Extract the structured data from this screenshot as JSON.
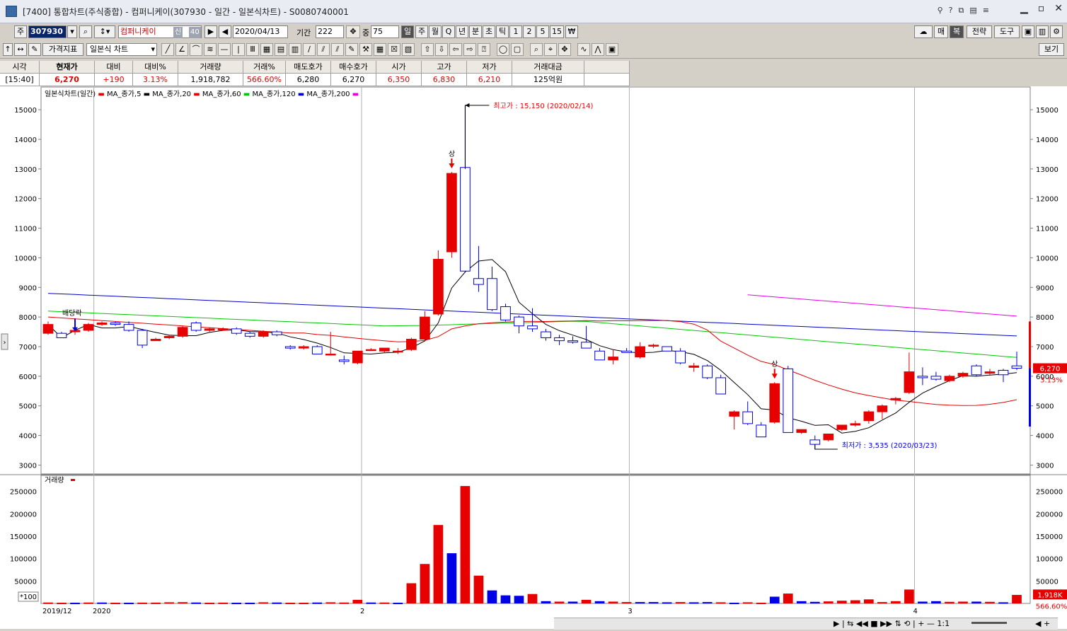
{
  "window": {
    "title": "[7400] 통합차트(주식종합) - 컴퍼니케이(307930 - 일간 - 일본식차트) - S0080740001"
  },
  "toolbar1": {
    "market": "주",
    "code": "307930",
    "name": "컴퍼니케이",
    "badge": "신",
    "badge2": "40",
    "date": "2020/04/13",
    "period_label": "기간",
    "period": "222",
    "zoom_label": "중",
    "zoom": "75",
    "periods": [
      "일",
      "주",
      "월",
      "Q",
      "년",
      "분",
      "초",
      "틱",
      "1",
      "2",
      "5",
      "15"
    ],
    "right_buttons": [
      "매",
      "복",
      "전략",
      "도구"
    ]
  },
  "toolbar2": {
    "indicator_label": "가격지표",
    "chart_type": "일본식 차트",
    "view_label": "보기"
  },
  "quote": {
    "headers": [
      "시각",
      "현재가",
      "대비",
      "대비%",
      "거래량",
      "거래%",
      "매도호가",
      "매수호가",
      "시가",
      "고가",
      "저가",
      "거래대금"
    ],
    "values": [
      "[15:40]",
      "6,270",
      "+190",
      "3.13%",
      "1,918,782",
      "566.60%",
      "6,280",
      "6,270",
      "6,350",
      "6,830",
      "6,210",
      "125억원"
    ]
  },
  "legend": {
    "title": "일본식차트(일간)",
    "items": [
      {
        "label": "MA_종가,5",
        "color": "#000000"
      },
      {
        "label": "MA_종가,20",
        "color": "#e60000"
      },
      {
        "label": "MA_종가,60",
        "color": "#00c800"
      },
      {
        "label": "MA_종가,120",
        "color": "#0000c8"
      },
      {
        "label": "MA_종가,200",
        "color": "#e600e6"
      }
    ],
    "marker_color": "#e60000"
  },
  "annotations": {
    "high": "최고가 : 15,150 (2020/02/14)",
    "low": "최저가 : 3,535 (2020/03/23)",
    "dividend": "배당락",
    "limit_up": "상",
    "price_tag": "6,270",
    "pct_tag": "3.13%",
    "vol_title": "거래량",
    "vol_tag": "1,918K",
    "vol_pct": "566.60%",
    "x100": "*100"
  },
  "colors": {
    "up": "#e60000",
    "down": "#0000e6",
    "ma5": "#000000",
    "ma20": "#e60000",
    "ma60": "#00c800",
    "ma120": "#0000c8",
    "ma200": "#e600e6"
  },
  "chart_data": {
    "type": "candlestick",
    "x_labels": [
      "2019/12",
      "2020",
      "2",
      "3",
      "4"
    ],
    "price_ticks": [
      3000,
      4000,
      5000,
      6000,
      7000,
      8000,
      9000,
      10000,
      11000,
      12000,
      13000,
      14000,
      15000
    ],
    "volume_ticks": [
      50000,
      100000,
      150000,
      200000,
      250000
    ],
    "candles": [
      {
        "o": 7450,
        "h": 7850,
        "l": 7400,
        "c": 7750
      },
      {
        "o": 7450,
        "h": 7500,
        "l": 7300,
        "c": 7300
      },
      {
        "o": 7500,
        "h": 7600,
        "l": 7400,
        "c": 7550
      },
      {
        "o": 7550,
        "h": 7800,
        "l": 7500,
        "c": 7750
      },
      {
        "o": 7750,
        "h": 7850,
        "l": 7700,
        "c": 7800
      },
      {
        "o": 7800,
        "h": 7850,
        "l": 7700,
        "c": 7750
      },
      {
        "o": 7750,
        "h": 7850,
        "l": 7500,
        "c": 7550
      },
      {
        "o": 7550,
        "h": 7600,
        "l": 6950,
        "c": 7050
      },
      {
        "o": 7200,
        "h": 7300,
        "l": 7200,
        "c": 7250
      },
      {
        "o": 7300,
        "h": 7400,
        "l": 7250,
        "c": 7350
      },
      {
        "o": 7350,
        "h": 7700,
        "l": 7300,
        "c": 7650
      },
      {
        "o": 7800,
        "h": 7850,
        "l": 7500,
        "c": 7550
      },
      {
        "o": 7550,
        "h": 7650,
        "l": 7500,
        "c": 7600
      },
      {
        "o": 7600,
        "h": 7650,
        "l": 7550,
        "c": 7600
      },
      {
        "o": 7600,
        "h": 7650,
        "l": 7400,
        "c": 7450
      },
      {
        "o": 7450,
        "h": 7500,
        "l": 7300,
        "c": 7350
      },
      {
        "o": 7350,
        "h": 7550,
        "l": 7300,
        "c": 7500
      },
      {
        "o": 7500,
        "h": 7550,
        "l": 7350,
        "c": 7400
      },
      {
        "o": 7000,
        "h": 7050,
        "l": 6900,
        "c": 6950
      },
      {
        "o": 6950,
        "h": 7050,
        "l": 6900,
        "c": 7000
      },
      {
        "o": 7000,
        "h": 7050,
        "l": 6750,
        "c": 6750
      },
      {
        "o": 6750,
        "h": 7500,
        "l": 6700,
        "c": 6750
      },
      {
        "o": 6550,
        "h": 6700,
        "l": 6400,
        "c": 6500
      },
      {
        "o": 6450,
        "h": 6850,
        "l": 6400,
        "c": 6850
      },
      {
        "o": 6900,
        "h": 6950,
        "l": 6850,
        "c": 6900
      },
      {
        "o": 6850,
        "h": 6950,
        "l": 6800,
        "c": 6950
      },
      {
        "o": 6850,
        "h": 6950,
        "l": 6750,
        "c": 6850
      },
      {
        "o": 6900,
        "h": 7300,
        "l": 6850,
        "c": 7250
      },
      {
        "o": 7250,
        "h": 8200,
        "l": 7200,
        "c": 8000
      },
      {
        "o": 8100,
        "h": 10250,
        "l": 8050,
        "c": 9950
      },
      {
        "o": 10200,
        "h": 12900,
        "l": 10000,
        "c": 12850
      },
      {
        "o": 13050,
        "h": 15150,
        "l": 9500,
        "c": 9550
      },
      {
        "o": 9300,
        "h": 10400,
        "l": 8850,
        "c": 9100
      },
      {
        "o": 9300,
        "h": 9700,
        "l": 8200,
        "c": 8250
      },
      {
        "o": 8350,
        "h": 8450,
        "l": 7850,
        "c": 7900
      },
      {
        "o": 8000,
        "h": 8050,
        "l": 7450,
        "c": 7700
      },
      {
        "o": 7700,
        "h": 8300,
        "l": 7500,
        "c": 7600
      },
      {
        "o": 7500,
        "h": 7600,
        "l": 7200,
        "c": 7300
      },
      {
        "o": 7300,
        "h": 7400,
        "l": 7050,
        "c": 7200
      },
      {
        "o": 7200,
        "h": 7350,
        "l": 7100,
        "c": 7150
      },
      {
        "o": 7150,
        "h": 7700,
        "l": 7050,
        "c": 6950
      },
      {
        "o": 6850,
        "h": 6950,
        "l": 6550,
        "c": 6550
      },
      {
        "o": 6550,
        "h": 6900,
        "l": 6400,
        "c": 6650
      },
      {
        "o": 6850,
        "h": 6950,
        "l": 6800,
        "c": 6800
      },
      {
        "o": 6650,
        "h": 7150,
        "l": 6600,
        "c": 7000
      },
      {
        "o": 7050,
        "h": 7100,
        "l": 6950,
        "c": 7050
      },
      {
        "o": 7000,
        "h": 7000,
        "l": 6850,
        "c": 6850
      },
      {
        "o": 6850,
        "h": 6950,
        "l": 6400,
        "c": 6450
      },
      {
        "o": 6300,
        "h": 6450,
        "l": 6150,
        "c": 6350
      },
      {
        "o": 6350,
        "h": 6400,
        "l": 5900,
        "c": 5950
      },
      {
        "o": 5950,
        "h": 6050,
        "l": 5400,
        "c": 5400
      },
      {
        "o": 4650,
        "h": 4850,
        "l": 4200,
        "c": 4800
      },
      {
        "o": 4800,
        "h": 5150,
        "l": 4350,
        "c": 4400
      },
      {
        "o": 4350,
        "h": 4450,
        "l": 3950,
        "c": 3950
      },
      {
        "o": 4450,
        "h": 5800,
        "l": 4400,
        "c": 5750
      },
      {
        "o": 6250,
        "h": 6350,
        "l": 4100,
        "c": 4100
      },
      {
        "o": 4100,
        "h": 4200,
        "l": 4050,
        "c": 4200
      },
      {
        "o": 3850,
        "h": 4000,
        "l": 3535,
        "c": 3700
      },
      {
        "o": 3850,
        "h": 4050,
        "l": 3800,
        "c": 4050
      },
      {
        "o": 4200,
        "h": 4350,
        "l": 4150,
        "c": 4350
      },
      {
        "o": 4350,
        "h": 4500,
        "l": 4300,
        "c": 4400
      },
      {
        "o": 4500,
        "h": 4850,
        "l": 4400,
        "c": 4800
      },
      {
        "o": 4800,
        "h": 5050,
        "l": 4550,
        "c": 5000
      },
      {
        "o": 5200,
        "h": 5300,
        "l": 5050,
        "c": 5250
      },
      {
        "o": 5450,
        "h": 6800,
        "l": 5400,
        "c": 6150
      },
      {
        "o": 6000,
        "h": 6300,
        "l": 5700,
        "c": 5950
      },
      {
        "o": 6000,
        "h": 6150,
        "l": 5850,
        "c": 5900
      },
      {
        "o": 5850,
        "h": 6050,
        "l": 5800,
        "c": 6000
      },
      {
        "o": 6000,
        "h": 6150,
        "l": 5950,
        "c": 6100
      },
      {
        "o": 6350,
        "h": 6400,
        "l": 6000,
        "c": 6050
      },
      {
        "o": 6100,
        "h": 6250,
        "l": 6050,
        "c": 6150
      },
      {
        "o": 6200,
        "h": 6250,
        "l": 5800,
        "c": 6050
      },
      {
        "o": 6350,
        "h": 6830,
        "l": 6210,
        "c": 6270
      }
    ],
    "volumes": [
      2000,
      1500,
      1500,
      2000,
      2000,
      1500,
      1500,
      1800,
      1800,
      2500,
      2800,
      2000,
      1500,
      1800,
      1500,
      1500,
      2500,
      2000,
      1500,
      1500,
      2000,
      2500,
      2000,
      8000,
      2000,
      2000,
      1500,
      45000,
      88000,
      175000,
      112000,
      262000,
      62000,
      29000,
      18000,
      17000,
      21000,
      5000,
      4000,
      4000,
      8000,
      5000,
      4000,
      3000,
      3000,
      3000,
      2500,
      3000,
      2500,
      3000,
      2500,
      1500,
      2500,
      1500,
      15000,
      22000,
      5000,
      3500,
      4500,
      6000,
      7000,
      9000,
      3000,
      5000,
      31000,
      4000,
      5000,
      3500,
      4000,
      4000,
      3500,
      2500,
      19000
    ],
    "volume_up": [
      1,
      1,
      0,
      1,
      0,
      1,
      0,
      1,
      1,
      1,
      1,
      0,
      1,
      1,
      0,
      0,
      1,
      0,
      1,
      1,
      0,
      1,
      1,
      1,
      0,
      1,
      0,
      1,
      1,
      1,
      0,
      1,
      1,
      0,
      0,
      0,
      1,
      0,
      1,
      0,
      1,
      0,
      1,
      1,
      0,
      0,
      0,
      1,
      0,
      0,
      1,
      0,
      1,
      1,
      0,
      1,
      0,
      0,
      1,
      1,
      1,
      1,
      1,
      1,
      1,
      0,
      0,
      1,
      1,
      0,
      1,
      0,
      1
    ],
    "ma_labels": [
      "MA_종가,5",
      "MA_종가,20",
      "MA_종가,60",
      "MA_종가,120",
      "MA_종가,200"
    ]
  }
}
